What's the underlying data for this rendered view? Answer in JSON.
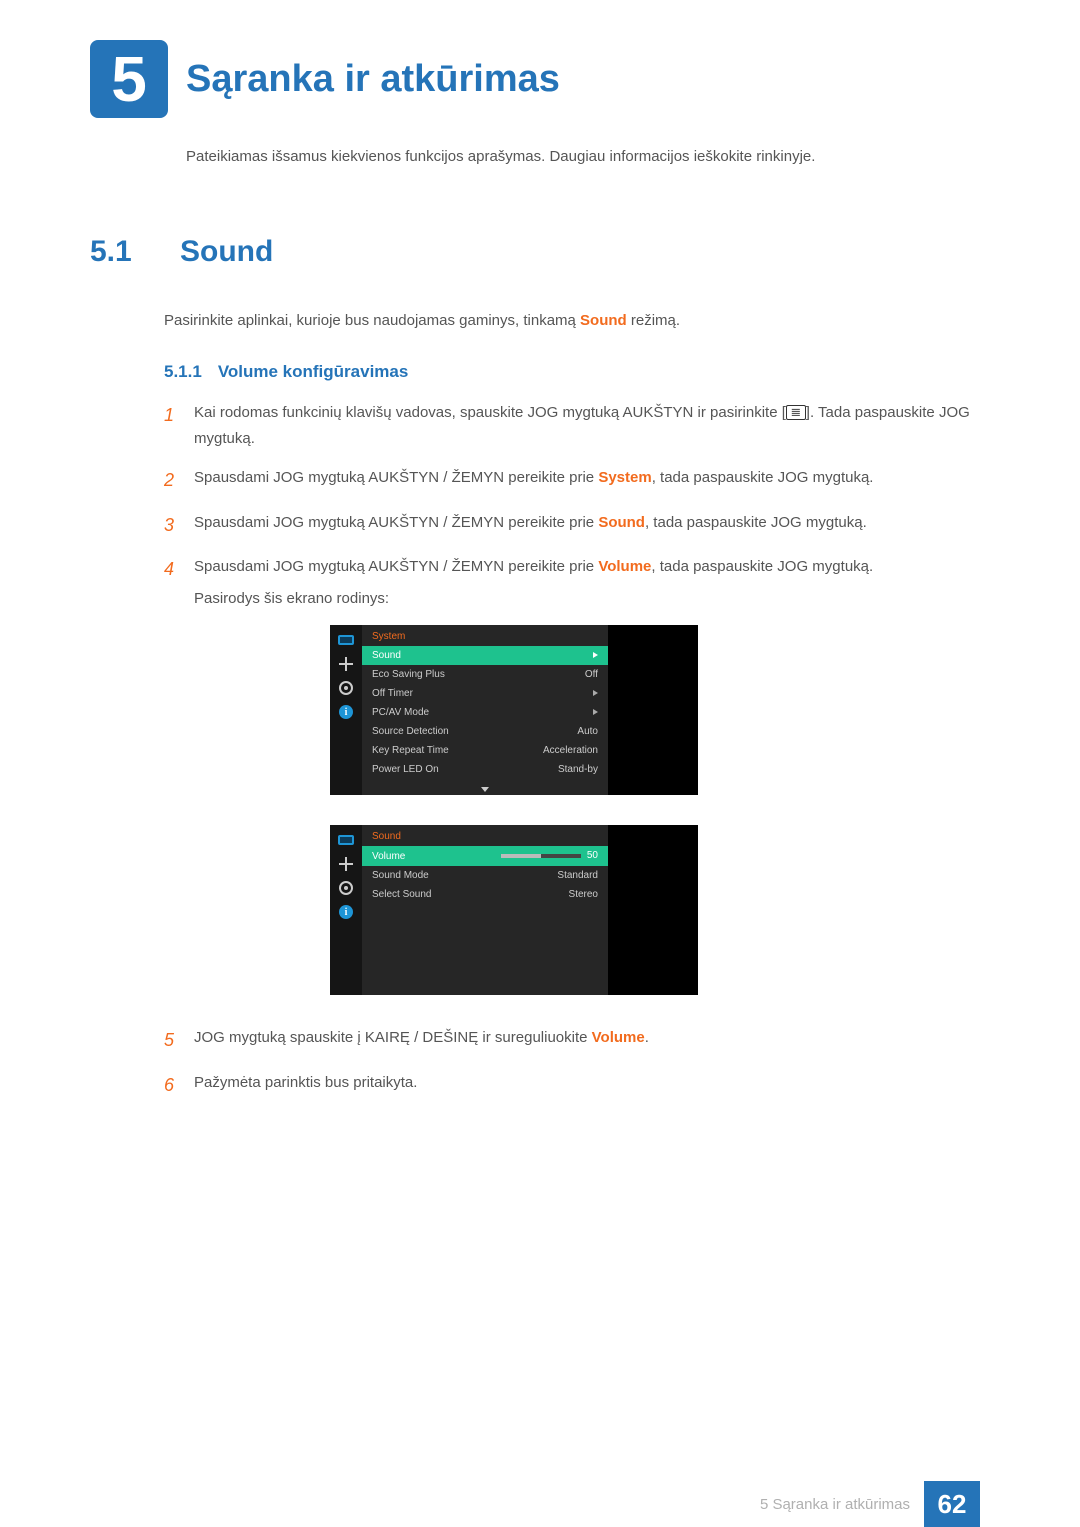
{
  "chapter": {
    "number": "5",
    "title": "Sąranka ir atkūrimas",
    "description": "Pateikiamas išsamus kiekvienos funkcijos aprašymas. Daugiau informacijos ieškokite rinkinyje."
  },
  "section": {
    "number": "5.1",
    "title": "Sound",
    "desc_pre": "Pasirinkite aplinkai, kurioje bus naudojamas gaminys, tinkamą ",
    "desc_bold": "Sound",
    "desc_post": " režimą."
  },
  "subsection": {
    "number": "5.1.1",
    "title": "Volume konfigūravimas"
  },
  "steps": [
    {
      "num": "1",
      "text": "Kai rodomas funkcinių klavišų vadovas, spauskite JOG mygtuką AUKŠTYN ir pasirinkite [",
      "icon": "menu-icon",
      "text_after_icon": "]. Tada paspauskite JOG mygtuką."
    },
    {
      "num": "2",
      "text": "Spausdami JOG mygtuką AUKŠTYN / ŽEMYN pereikite prie ",
      "bold": "System",
      "text_after_bold": ", tada paspauskite JOG mygtuką."
    },
    {
      "num": "3",
      "text": "Spausdami JOG mygtuką AUKŠTYN / ŽEMYN pereikite prie ",
      "bold": "Sound",
      "text_after_bold": ", tada paspauskite JOG mygtuką."
    },
    {
      "num": "4",
      "text": "Spausdami JOG mygtuką AUKŠTYN / ŽEMYN pereikite prie ",
      "bold": "Volume",
      "text_after_bold": ", tada paspauskite JOG mygtuką.",
      "after": "Pasirodys šis ekrano rodinys:"
    },
    {
      "num": "5",
      "text": "JOG mygtuką spauskite į KAIRĘ / DEŠINĘ ir sureguliuokite ",
      "bold": "Volume",
      "text_after_bold": "."
    },
    {
      "num": "6",
      "text": "Pažymėta parinktis bus pritaikyta."
    }
  ],
  "icon_glyph": "𝌆",
  "osd1": {
    "header": "System",
    "rows": [
      {
        "label": "Sound",
        "value": "",
        "arrow": true,
        "selected": true
      },
      {
        "label": "Eco Saving Plus",
        "value": "Off"
      },
      {
        "label": "Off Timer",
        "value": "",
        "arrow": true
      },
      {
        "label": "PC/AV Mode",
        "value": "",
        "arrow": true
      },
      {
        "label": "Source Detection",
        "value": "Auto"
      },
      {
        "label": "Key Repeat Time",
        "value": "Acceleration"
      },
      {
        "label": "Power LED On",
        "value": "Stand-by"
      }
    ]
  },
  "osd2": {
    "header": "Sound",
    "rows": [
      {
        "label": "Volume",
        "slider": true,
        "value": "50",
        "selected": true
      },
      {
        "label": "Sound Mode",
        "value": "Standard"
      },
      {
        "label": "Select Sound",
        "value": "Stereo"
      }
    ]
  },
  "footer": {
    "label": "5 Sąranka ir atkūrimas",
    "page": "62"
  }
}
